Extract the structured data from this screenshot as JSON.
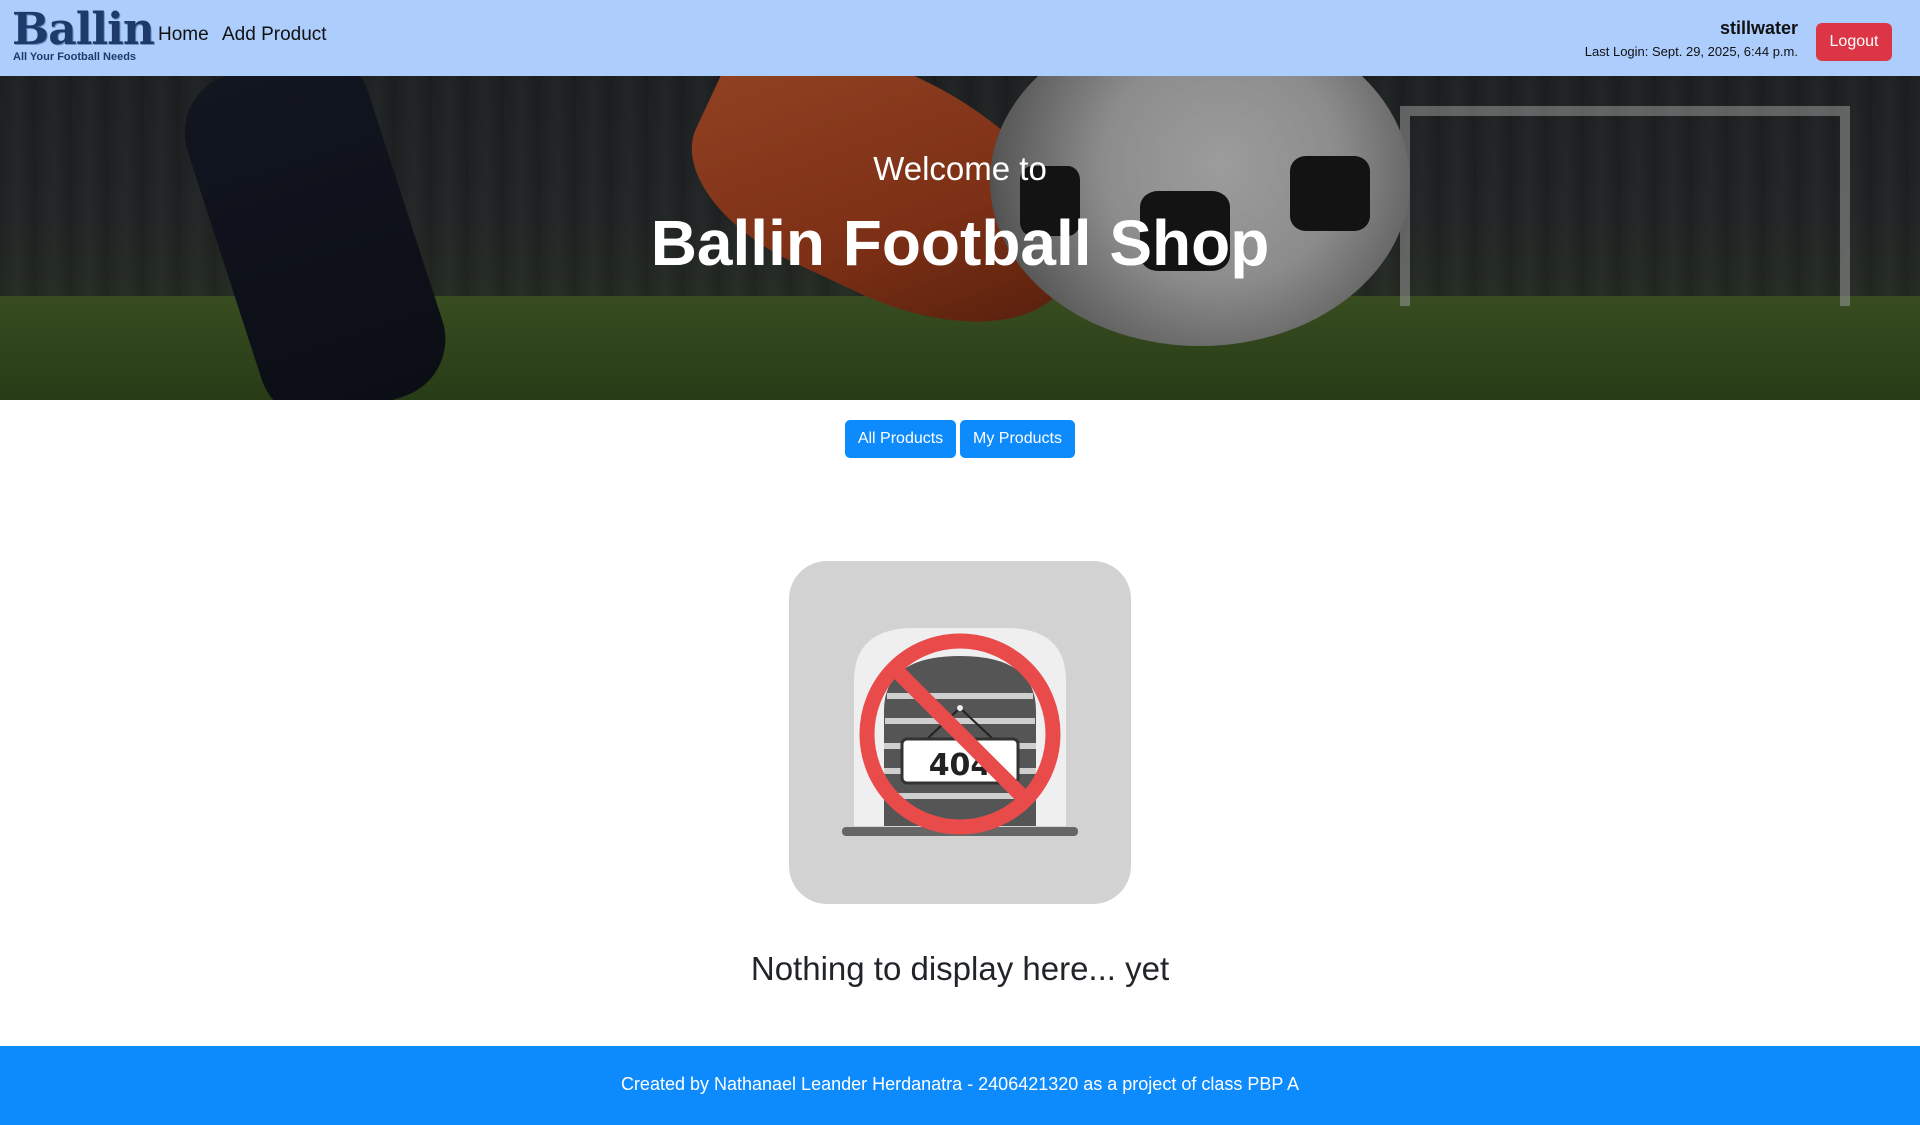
{
  "navbar": {
    "logo_text": "Ballin",
    "logo_tagline": "All Your Football Needs",
    "links": [
      "Home",
      "Add Product"
    ],
    "username": "stillwater",
    "last_login": "Last Login: Sept. 29, 2025, 6:44 p.m.",
    "logout_label": "Logout"
  },
  "hero": {
    "subtitle": "Welcome to",
    "title": "Ballin Football Shop"
  },
  "filters": {
    "all_label": "All Products",
    "mine_label": "My Products"
  },
  "empty_state": {
    "image_label": "404",
    "message": "Nothing to display here... yet"
  },
  "footer": {
    "text": "Created by Nathanael Leander Herdanatra - 2406421320 as a project of class PBP A"
  },
  "colors": {
    "navbar_bg": "#adcdfd",
    "primary": "#0d8bfd",
    "danger": "#dc3545"
  }
}
